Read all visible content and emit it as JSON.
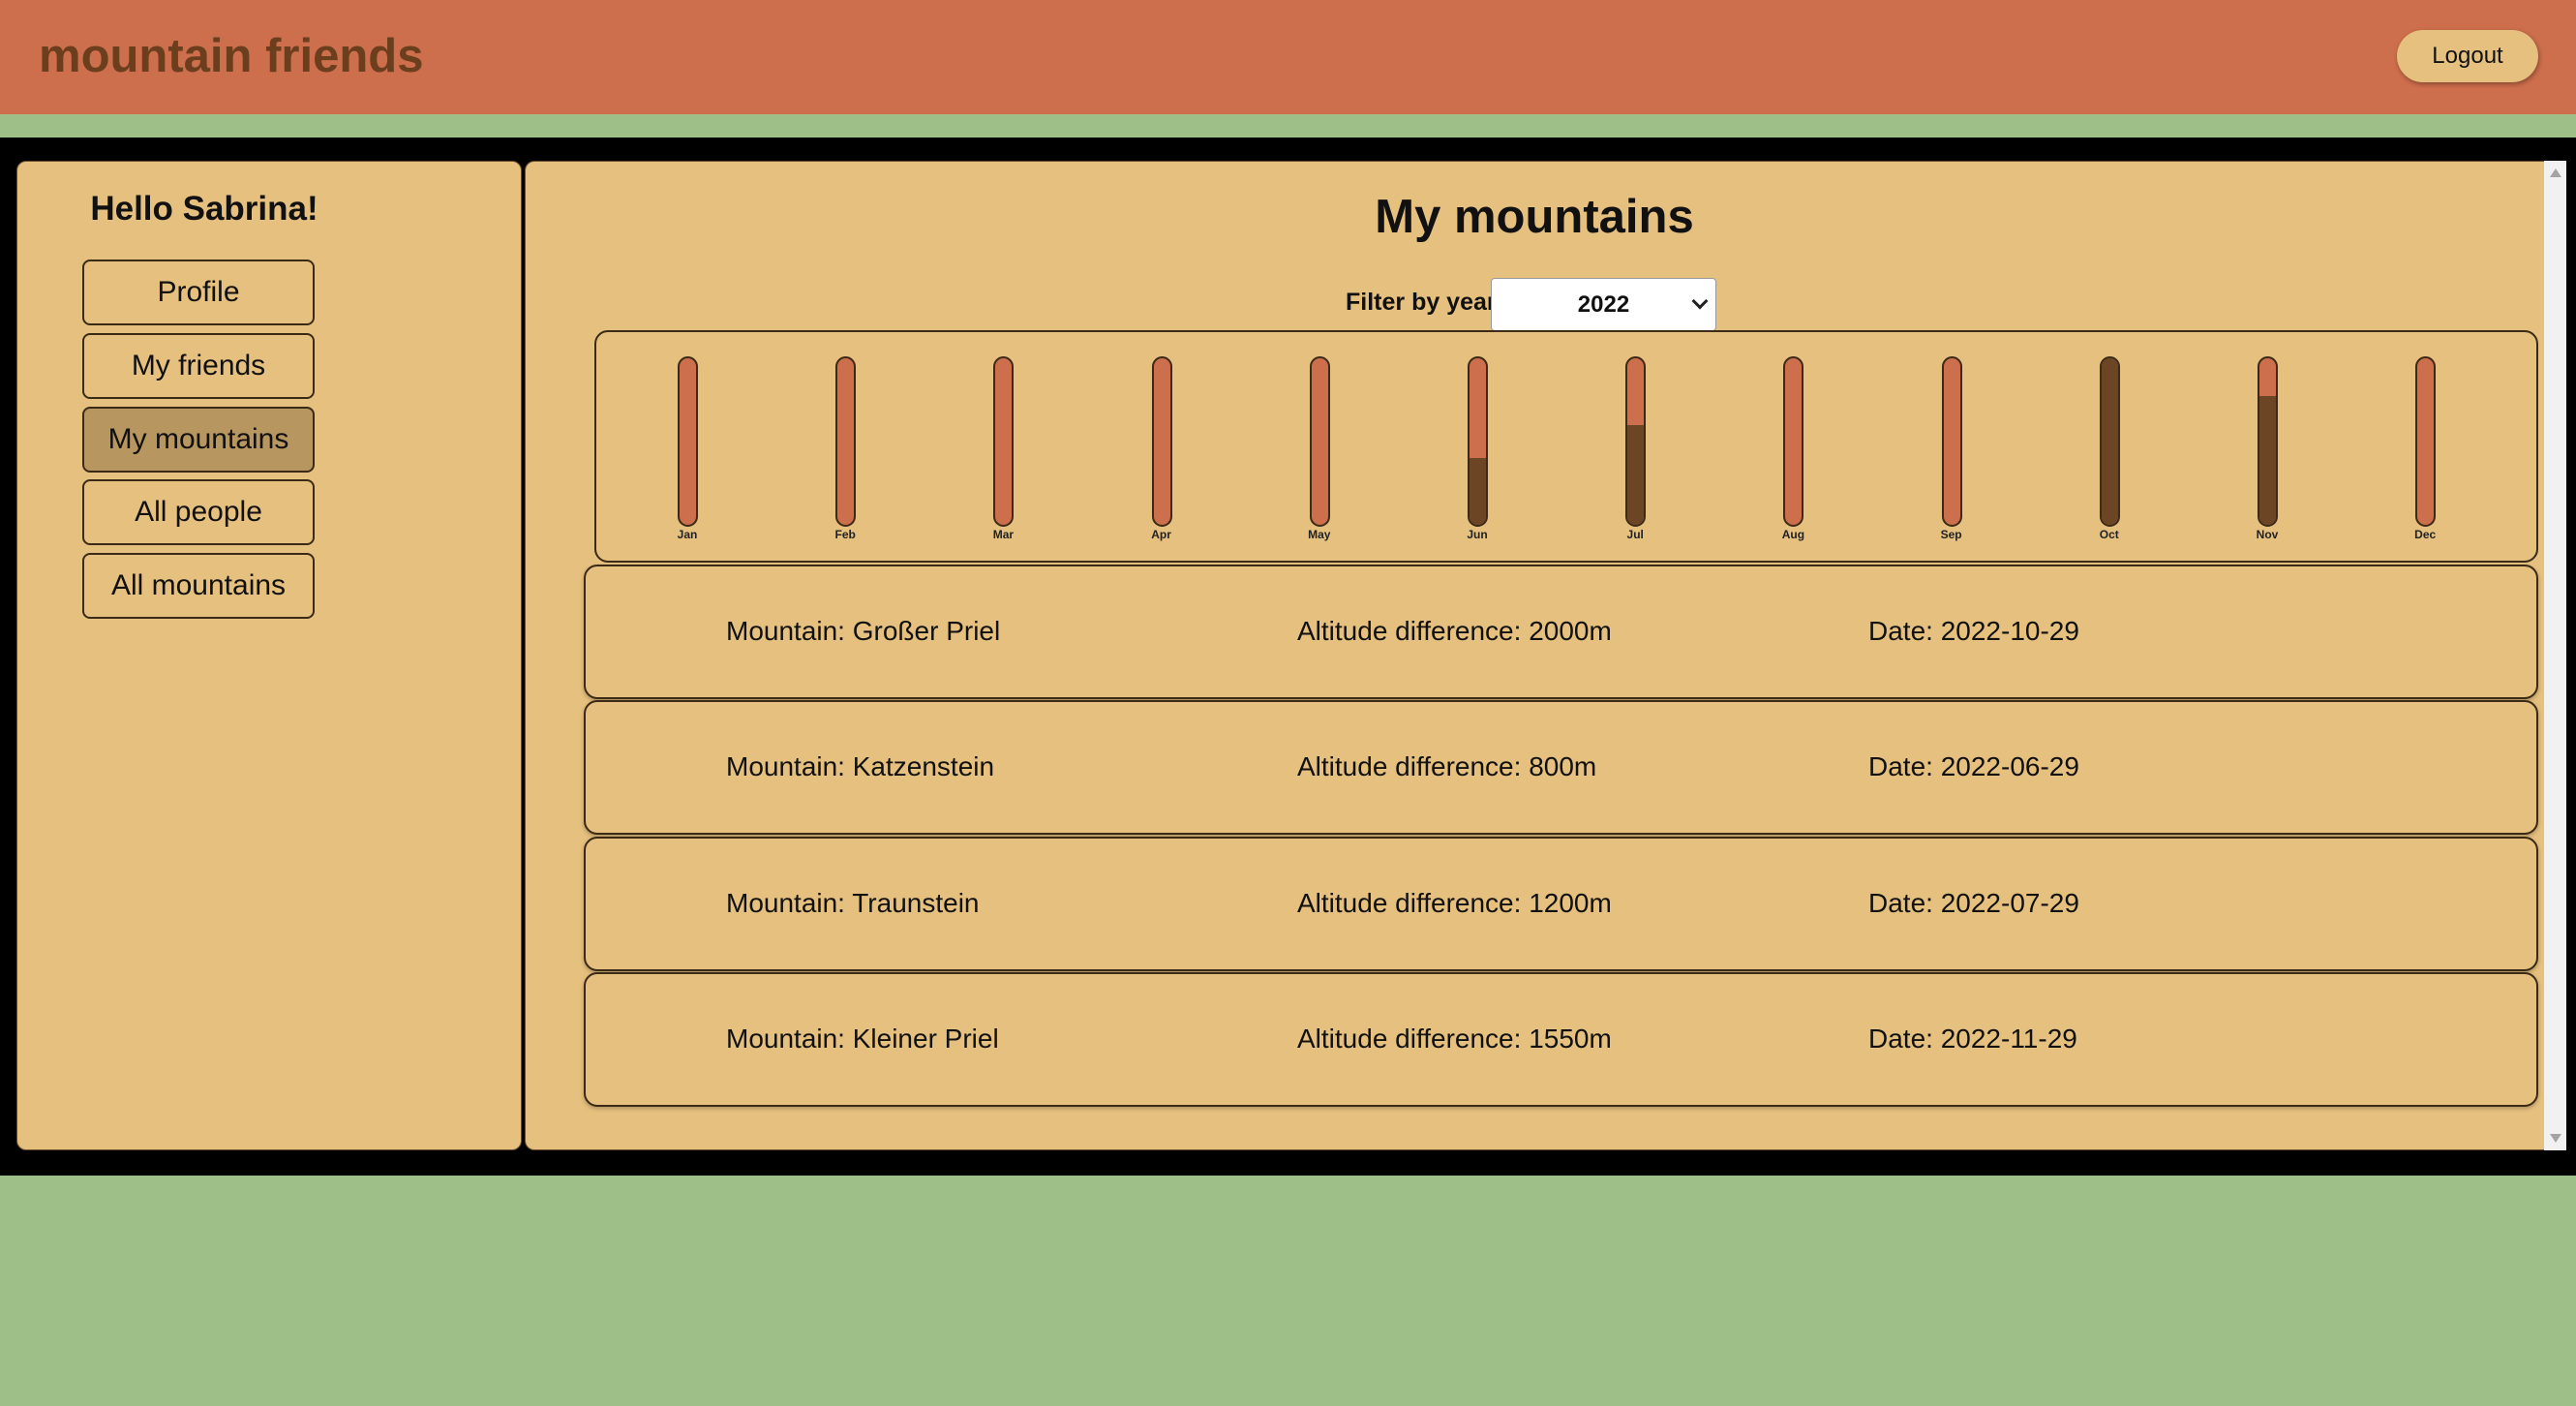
{
  "header": {
    "brand": "mountain friends",
    "logout_label": "Logout",
    "bg_color": "#cd6e4c"
  },
  "sidebar": {
    "greeting": "Hello Sabrina!",
    "items": [
      {
        "label": "Profile",
        "active": false
      },
      {
        "label": "My friends",
        "active": false
      },
      {
        "label": "My mountains",
        "active": true
      },
      {
        "label": "All people",
        "active": false
      },
      {
        "label": "All mountains",
        "active": false
      }
    ]
  },
  "main": {
    "title": "My mountains",
    "filter_label": "Filter by year",
    "year_value": "2022"
  },
  "chart_data": {
    "type": "bar",
    "categories": [
      "Jan",
      "Feb",
      "Mar",
      "Apr",
      "May",
      "Jun",
      "Jul",
      "Aug",
      "Sep",
      "Oct",
      "Nov",
      "Dec"
    ],
    "values": [
      0,
      0,
      0,
      0,
      0,
      800,
      1200,
      0,
      0,
      2000,
      1550,
      0
    ],
    "ylim": [
      0,
      2000
    ],
    "colors": {
      "track": "#cd6e4c",
      "fill": "#6b4524"
    }
  },
  "entries": [
    {
      "mountain": "Mountain: Großer Priel",
      "altitude": "Altitude difference: 2000m",
      "date": "Date: 2022-10-29"
    },
    {
      "mountain": "Mountain: Katzenstein",
      "altitude": "Altitude difference: 800m",
      "date": "Date: 2022-06-29"
    },
    {
      "mountain": "Mountain: Traunstein",
      "altitude": "Altitude difference: 1200m",
      "date": "Date: 2022-07-29"
    },
    {
      "mountain": "Mountain: Kleiner Priel",
      "altitude": "Altitude difference: 1550m",
      "date": "Date: 2022-11-29"
    }
  ]
}
